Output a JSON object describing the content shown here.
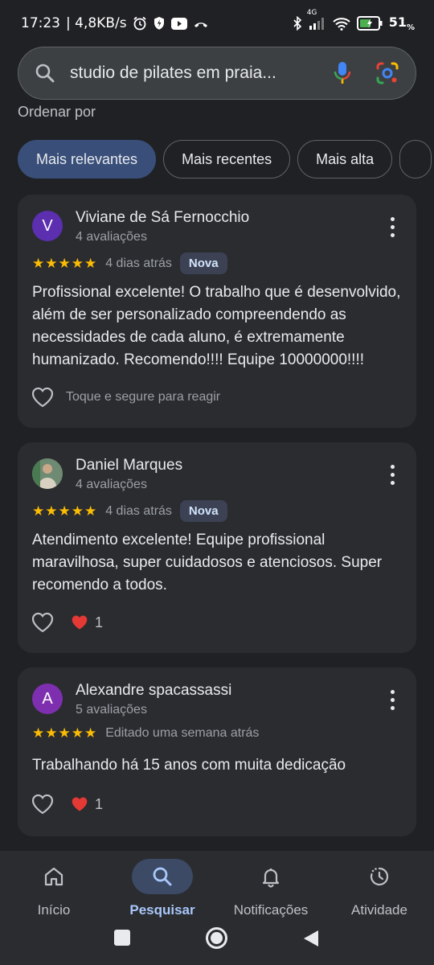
{
  "status_bar": {
    "time": "17:23",
    "network_speed": "| 4,8KB/s",
    "battery_percent": "51",
    "battery_unit": "%",
    "network_type": "4G",
    "icons": [
      "alarm-icon",
      "shield-icon",
      "youtube-icon",
      "missed-call-icon",
      "bluetooth-icon",
      "signal-icon",
      "wifi-icon",
      "battery-icon"
    ]
  },
  "search": {
    "query": "studio de pilates em praia..."
  },
  "sort": {
    "label": "Ordenar por",
    "chips": [
      {
        "label": "Mais relevantes",
        "active": true
      },
      {
        "label": "Mais recentes",
        "active": false
      },
      {
        "label": "Mais alta",
        "active": false
      }
    ]
  },
  "reviews": [
    {
      "avatar_letter": "V",
      "avatar_color": "#5b2fb0",
      "name": "Viviane de Sá Fernocchio",
      "count": "4 avaliações",
      "stars": "★★★★★",
      "rating": 5,
      "when": "4 dias atrás",
      "badge": "Nova",
      "text": "Profissional excelente! O trabalho que é desenvolvido, além de ser personalizado compreendendo as necessidades de cada aluno, é extremamente humanizado. Recomendo!!!! Equipe 10000000!!!!",
      "react_hint": "Toque e segure para reagir"
    },
    {
      "avatar_letter": "",
      "avatar_color": "#4a6b5a",
      "name": "Daniel Marques",
      "count": "4 avaliações",
      "stars": "★★★★★",
      "rating": 5,
      "when": "4 dias atrás",
      "badge": "Nova",
      "text": "Atendimento excelente! Equipe profissional maravilhosa, super cuidadosos e atenciosos. Super recomendo a todos.",
      "hearts": "1"
    },
    {
      "avatar_letter": "A",
      "avatar_color": "#7e2fb0",
      "name": "Alexandre spacassassi",
      "count": "5 avaliações",
      "stars": "★★★★★",
      "rating": 5,
      "when": "Editado uma semana atrás",
      "text": "Trabalhando há 15 anos com muita dedicação",
      "hearts": "1"
    }
  ],
  "bottom_nav": {
    "items": [
      {
        "label": "Início",
        "icon": "home-icon"
      },
      {
        "label": "Pesquisar",
        "icon": "search-icon",
        "active": true
      },
      {
        "label": "Notificações",
        "icon": "bell-icon"
      },
      {
        "label": "Atividade",
        "icon": "activity-icon"
      }
    ]
  },
  "colors": {
    "background": "#202124",
    "card": "#2b2c30",
    "accent": "#a8c7fa",
    "star": "#fbbc04",
    "active_chip": "#394f7a"
  }
}
